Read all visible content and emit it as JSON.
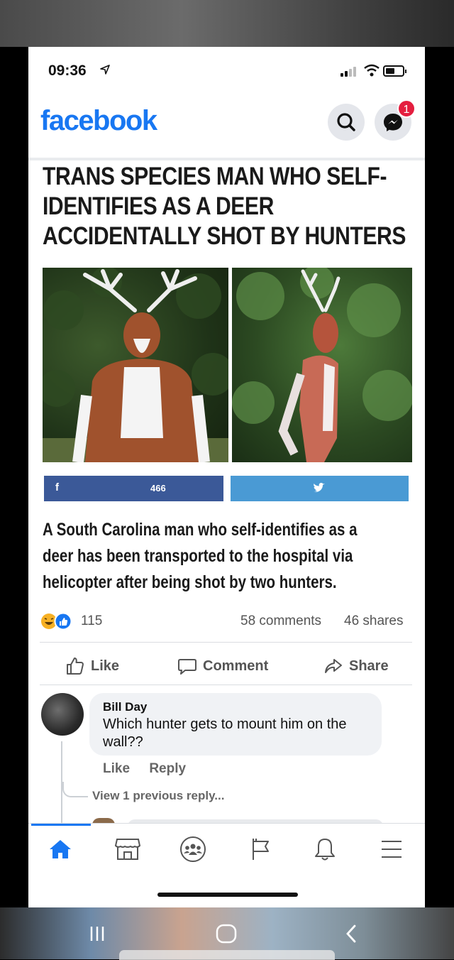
{
  "status_bar": {
    "time": "09:36"
  },
  "header": {
    "logo": "facebook",
    "messenger_badge": "1"
  },
  "post": {
    "headline": "TRANS SPECIES MAN WHO SELF-IDENTIFIES AS A DEER ACCIDENTALLY SHOT BY HUNTERS",
    "share_count": "466",
    "summary": "A South Carolina man who self-identifies as a deer has been transported to the hospital via helicopter after being shot by two hunters.",
    "reactions_count": "115",
    "comments_count": "58 comments",
    "shares_count": "46 shares"
  },
  "actions": {
    "like": "Like",
    "comment": "Comment",
    "share": "Share"
  },
  "comment": {
    "author": "Bill Day",
    "text": "Which hunter gets to mount him on the wall??",
    "like": "Like",
    "reply": "Reply",
    "view_previous": "View 1 previous reply..."
  },
  "colors": {
    "brand": "#1877f2",
    "fb_share": "#3b5998",
    "tw_share": "#4a9ad4",
    "badge": "#e41e3f"
  },
  "nav": [
    "home-icon",
    "marketplace-icon",
    "groups-icon",
    "pages-flag-icon",
    "notifications-bell-icon",
    "menu-icon"
  ]
}
